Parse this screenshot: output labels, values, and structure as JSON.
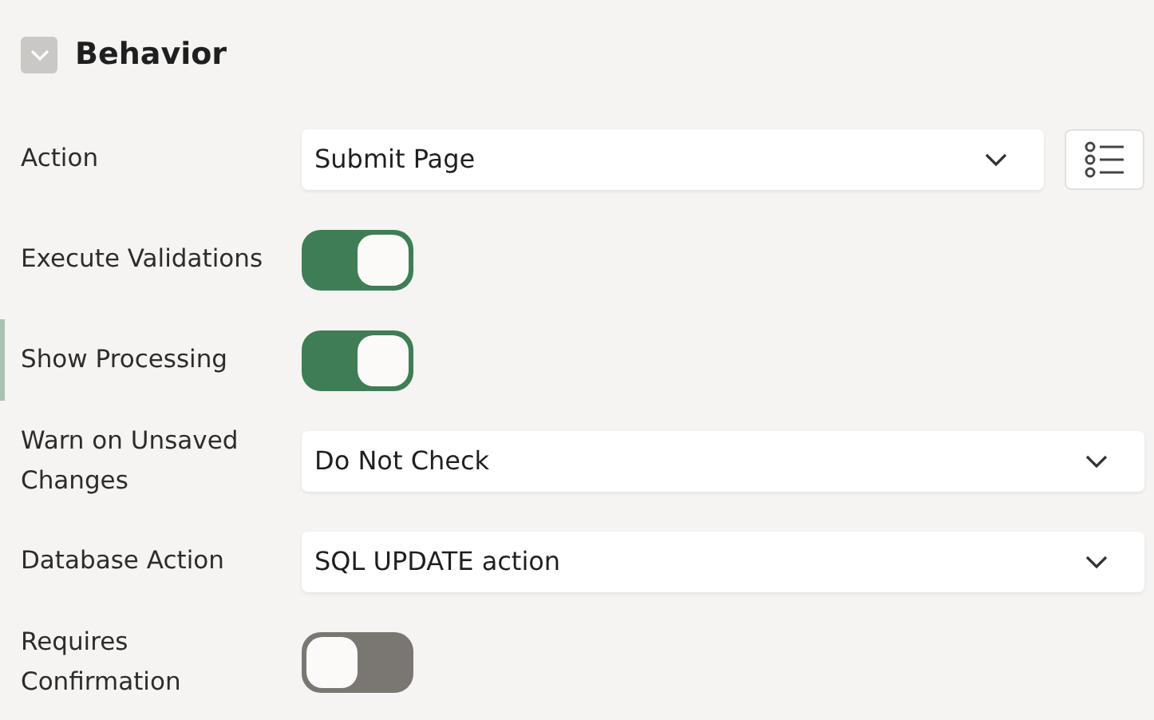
{
  "section": {
    "title": "Behavior",
    "expanded": true
  },
  "fields": [
    {
      "label": "Action",
      "kind": "select",
      "value": "Submit Page",
      "list_button": true,
      "selected": false
    },
    {
      "label": "Execute Validations",
      "kind": "toggle",
      "on": true,
      "selected": false
    },
    {
      "label": "Show Processing",
      "kind": "toggle",
      "on": true,
      "selected": true
    },
    {
      "label": "Warn on Unsaved Changes",
      "kind": "select",
      "value": "Do Not Check",
      "selected": false
    },
    {
      "label": "Database Action",
      "kind": "select",
      "value": "SQL UPDATE action",
      "selected": false
    },
    {
      "label": "Requires Confirmation",
      "kind": "toggle",
      "on": false,
      "selected": false
    }
  ]
}
